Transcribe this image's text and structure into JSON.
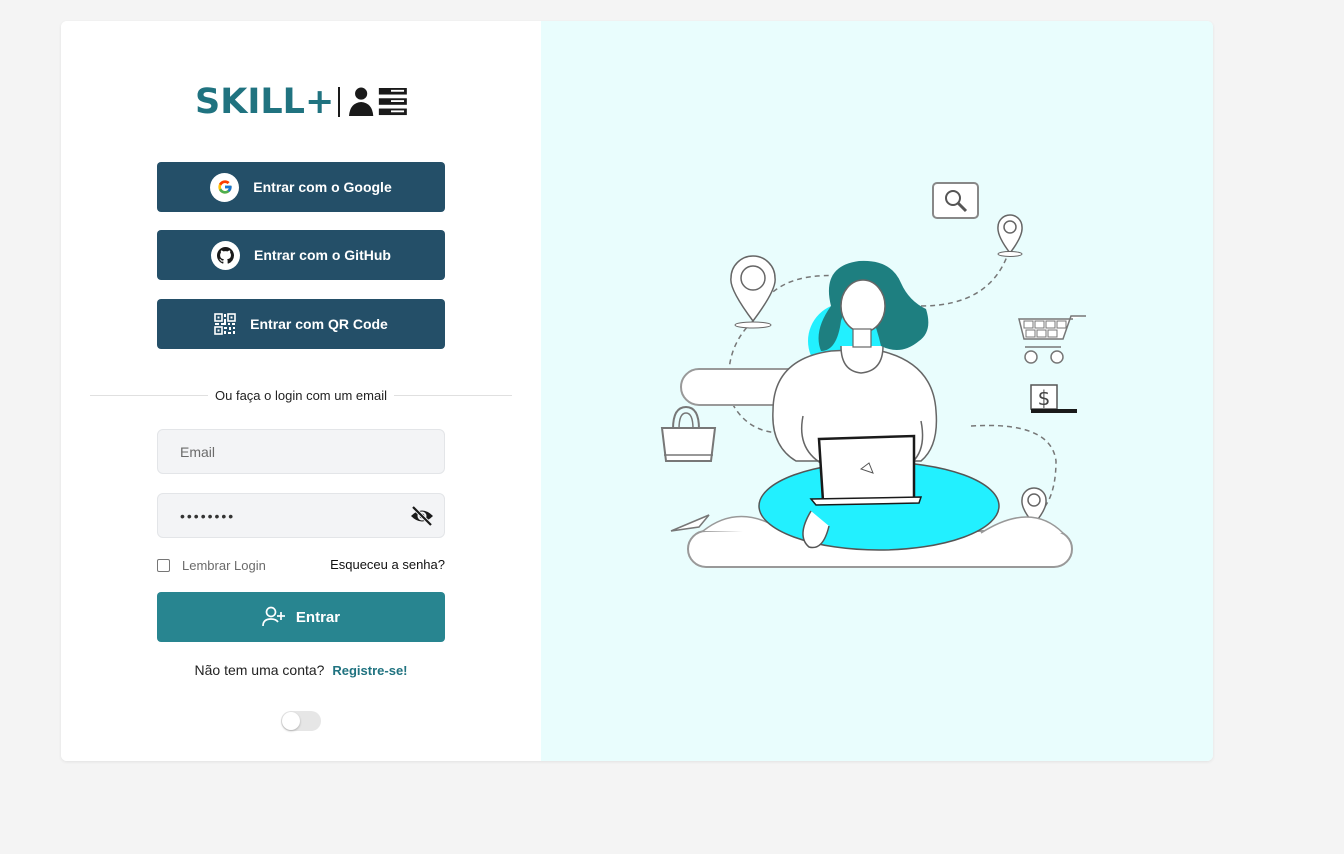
{
  "brand": {
    "logo_text": "SKILL+",
    "accent_color": "#207380"
  },
  "social": {
    "google_label": "Entrar com o Google",
    "github_label": "Entrar com o GitHub",
    "qr_label": "Entrar com QR Code",
    "button_color": "#244f68"
  },
  "divider_text": "Ou faça o login com um email",
  "form": {
    "email_placeholder": "Email",
    "password_value": "12345678",
    "remember_label": "Lembrar Login",
    "forgot_label": "Esqueceu a senha?",
    "submit_label": "Entrar",
    "submit_color": "#288590"
  },
  "signup": {
    "prompt": "Não tem uma conta?",
    "link_label": "Registre-se!"
  },
  "theme_toggle": {
    "on": false
  },
  "icons": {
    "logo": "user-list-icon",
    "google": "google-icon",
    "github": "github-icon",
    "qr": "qr-code-icon",
    "password_visibility": "eye-off-icon",
    "submit": "user-plus-icon"
  },
  "illustration": {
    "accent_color": "#22f0ff",
    "hair_color": "#1e7f80"
  }
}
